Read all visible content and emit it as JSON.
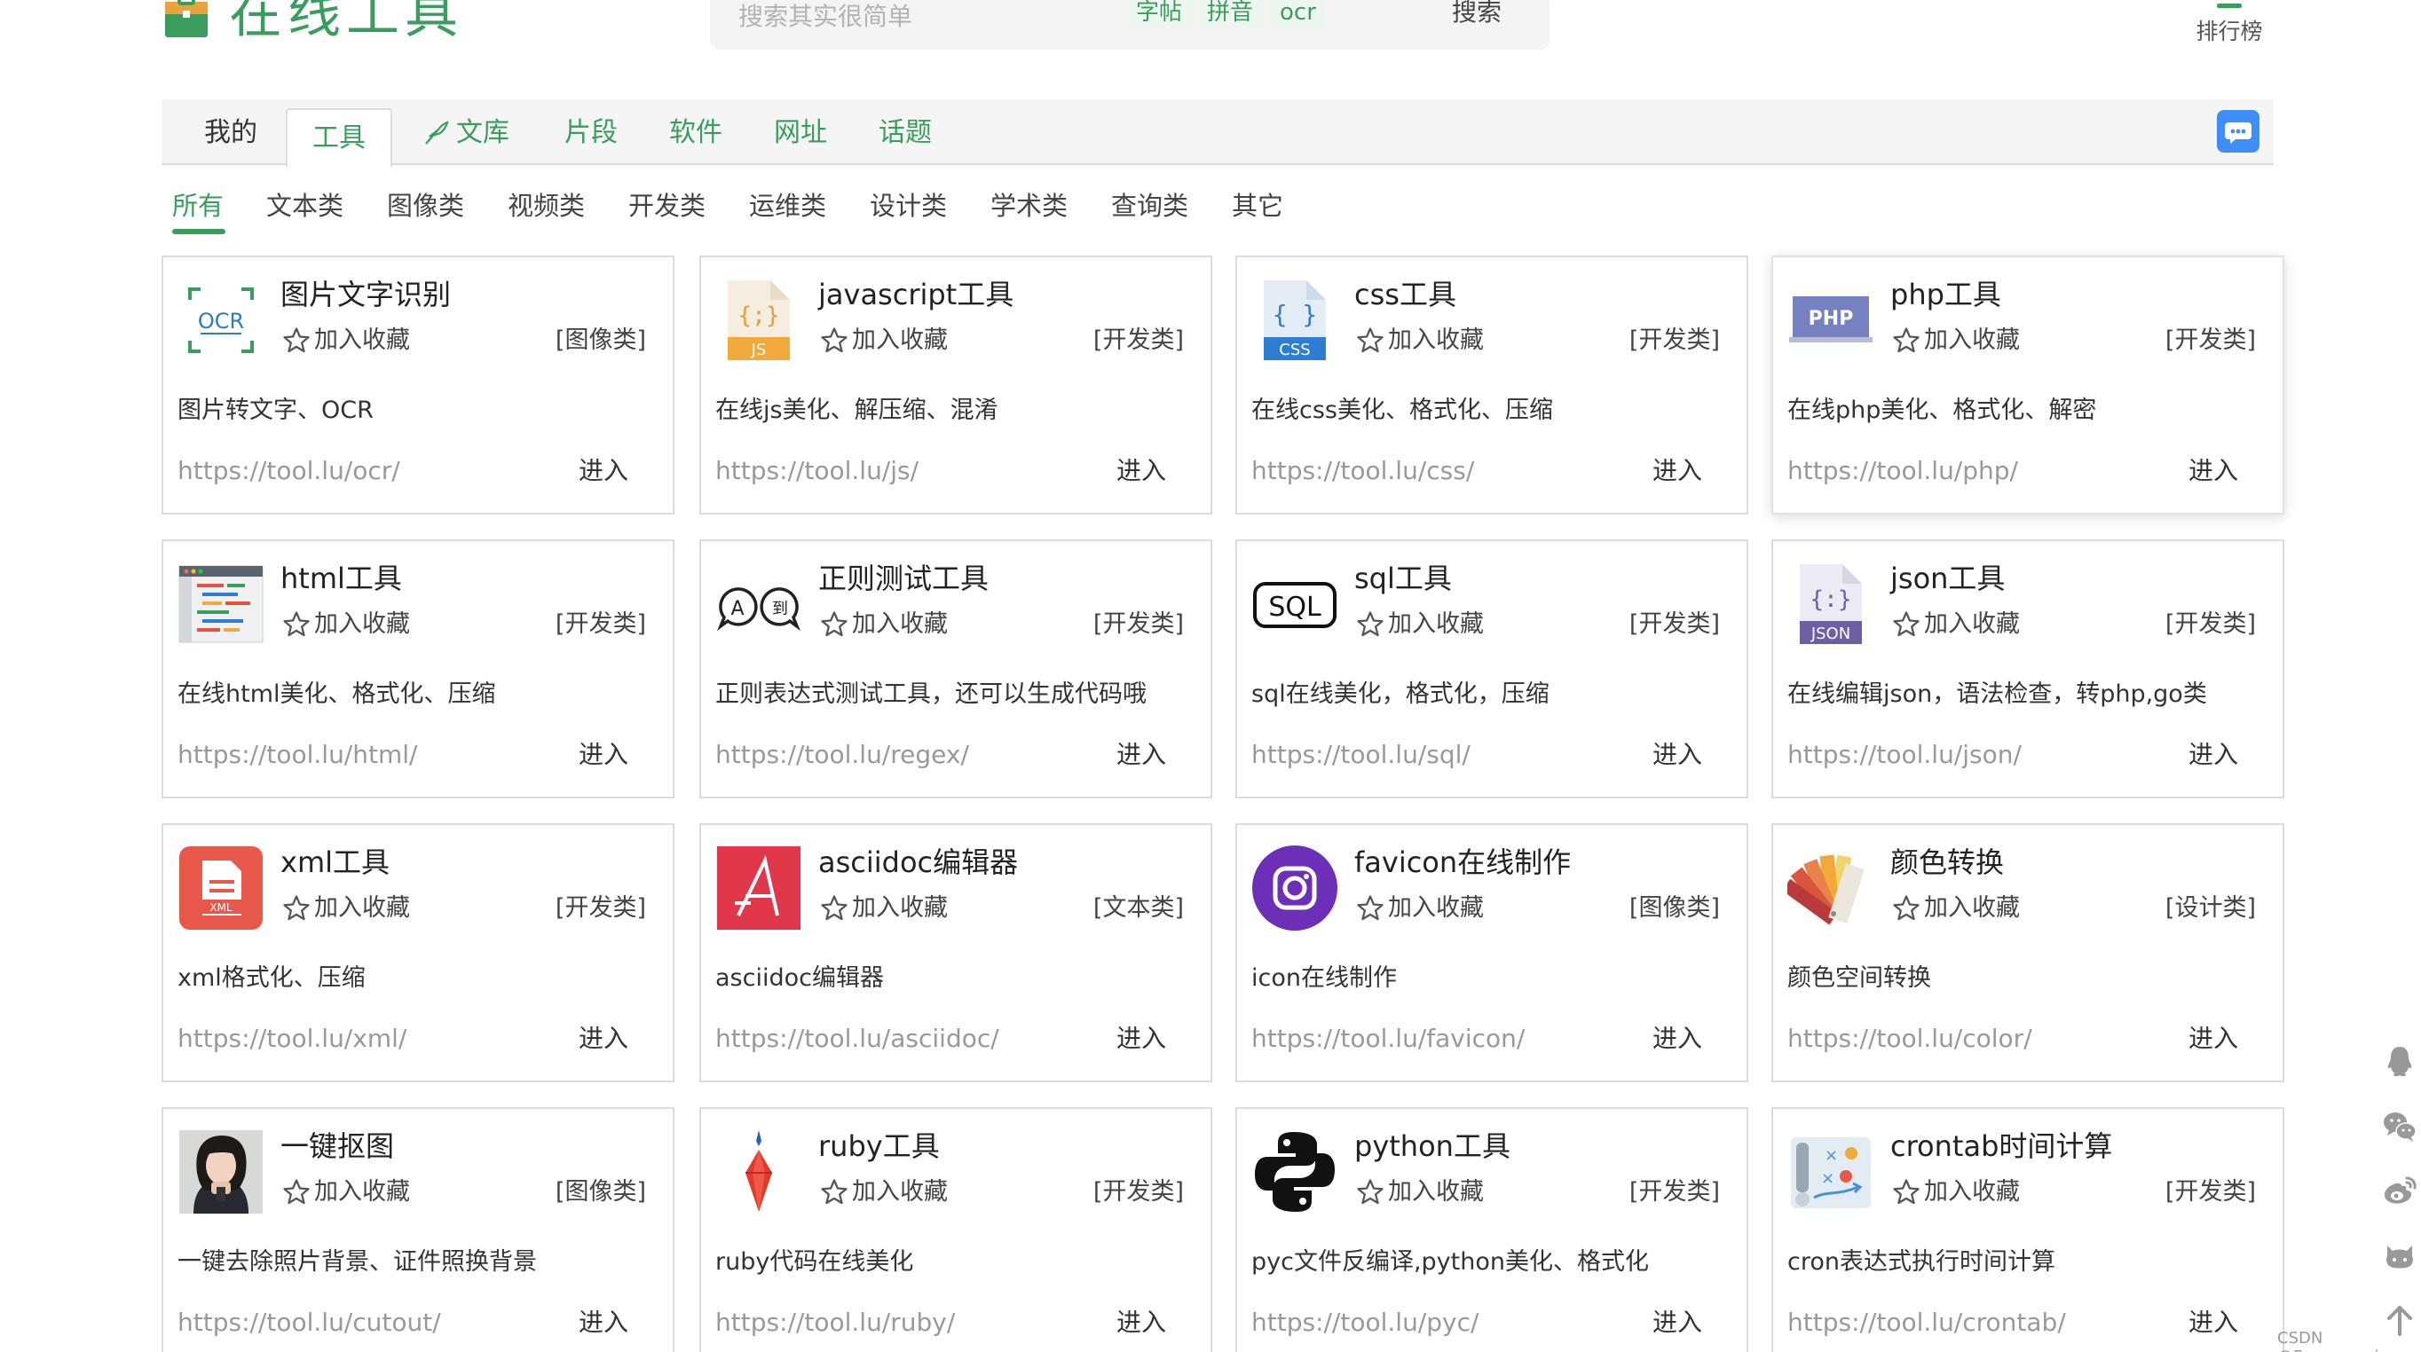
{
  "header": {
    "logo_text": "在线工具",
    "search": {
      "placeholder": "搜索其实很简单",
      "tags": [
        "字帖",
        "拼音",
        "ocr"
      ],
      "button_label": "搜索"
    },
    "rank_label": "排行榜"
  },
  "nav": {
    "items": [
      {
        "label": "我的"
      },
      {
        "label": "工具"
      },
      {
        "label": "文库"
      },
      {
        "label": "片段"
      },
      {
        "label": "软件"
      },
      {
        "label": "网址"
      },
      {
        "label": "话题"
      }
    ],
    "active": "工具"
  },
  "filters": {
    "items": [
      "所有",
      "文本类",
      "图像类",
      "视频类",
      "开发类",
      "运维类",
      "设计类",
      "学术类",
      "查询类",
      "其它"
    ],
    "active": "所有"
  },
  "fav_label": "加入收藏",
  "enter_label": "进入",
  "cards": [
    {
      "title": "图片文字识别",
      "category": "[图像类]",
      "desc": "图片转文字、OCR",
      "url": "https://tool.lu/ocr/",
      "icon": "ocr-icon"
    },
    {
      "title": "javascript工具",
      "category": "[开发类]",
      "desc": "在线js美化、解压缩、混淆",
      "url": "https://tool.lu/js/",
      "icon": "js-file-icon"
    },
    {
      "title": "css工具",
      "category": "[开发类]",
      "desc": "在线css美化、格式化、压缩",
      "url": "https://tool.lu/css/",
      "icon": "css-file-icon"
    },
    {
      "title": "php工具",
      "category": "[开发类]",
      "desc": "在线php美化、格式化、解密",
      "url": "https://tool.lu/php/",
      "icon": "php-icon"
    },
    {
      "title": "html工具",
      "category": "[开发类]",
      "desc": "在线html美化、格式化、压缩",
      "url": "https://tool.lu/html/",
      "icon": "html-editor-icon"
    },
    {
      "title": "正则测试工具",
      "category": "[开发类]",
      "desc": "正则表达式测试工具，还可以生成代码哦",
      "url": "https://tool.lu/regex/",
      "icon": "regex-icon"
    },
    {
      "title": "sql工具",
      "category": "[开发类]",
      "desc": "sql在线美化，格式化，压缩",
      "url": "https://tool.lu/sql/",
      "icon": "sql-icon"
    },
    {
      "title": "json工具",
      "category": "[开发类]",
      "desc": "在线编辑json，语法检查，转php,go类",
      "url": "https://tool.lu/json/",
      "icon": "json-file-icon"
    },
    {
      "title": "xml工具",
      "category": "[开发类]",
      "desc": "xml格式化、压缩",
      "url": "https://tool.lu/xml/",
      "icon": "xml-file-icon"
    },
    {
      "title": "asciidoc编辑器",
      "category": "[文本类]",
      "desc": "asciidoc编辑器",
      "url": "https://tool.lu/asciidoc/",
      "icon": "asciidoc-icon"
    },
    {
      "title": "favicon在线制作",
      "category": "[图像类]",
      "desc": "icon在线制作",
      "url": "https://tool.lu/favicon/",
      "icon": "favicon-camera-icon"
    },
    {
      "title": "颜色转换",
      "category": "[设计类]",
      "desc": "颜色空间转换",
      "url": "https://tool.lu/color/",
      "icon": "color-swatch-icon"
    },
    {
      "title": "一键抠图",
      "category": "[图像类]",
      "desc": "一键去除照片背景、证件照换背景",
      "url": "https://tool.lu/cutout/",
      "icon": "portrait-photo-icon"
    },
    {
      "title": "ruby工具",
      "category": "[开发类]",
      "desc": "ruby代码在线美化",
      "url": "https://tool.lu/ruby/",
      "icon": "ruby-gem-icon"
    },
    {
      "title": "python工具",
      "category": "[开发类]",
      "desc": "pyc文件反编译,python美化、格式化",
      "url": "https://tool.lu/pyc/",
      "icon": "python-logo-icon"
    },
    {
      "title": "crontab时间计算",
      "category": "[开发类]",
      "desc": "cron表达式执行时间计算",
      "url": "https://tool.lu/crontab/",
      "icon": "crontab-icon"
    }
  ],
  "side_toolbar": [
    "qq-icon",
    "wechat-icon",
    "weibo-icon",
    "github-icon",
    "back-to-top-icon"
  ],
  "watermark": "CSDN @Forever_wj",
  "colors": {
    "accent": "#3a9d5d",
    "chat": "#3d8ff7"
  }
}
